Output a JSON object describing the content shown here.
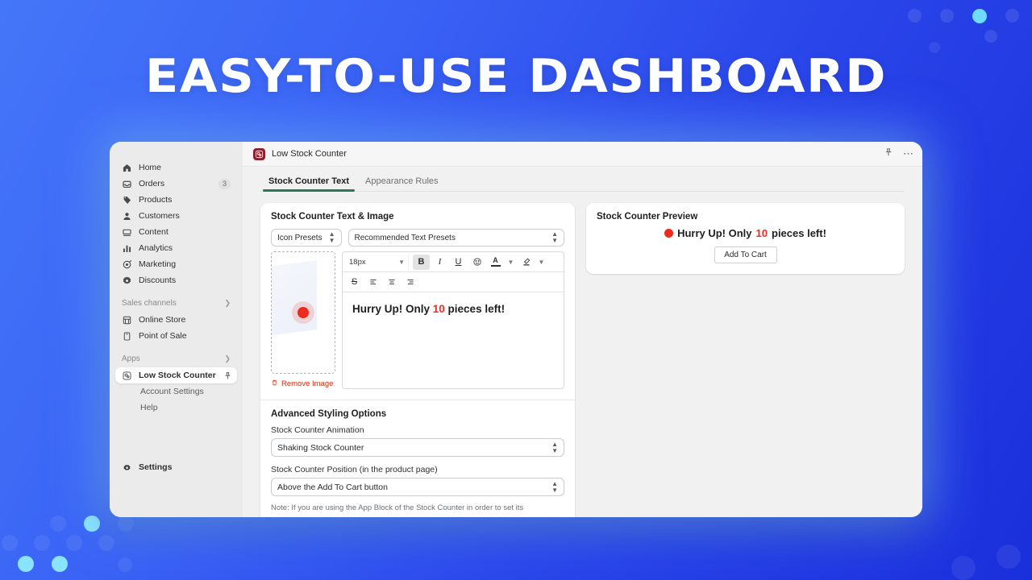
{
  "hero": {
    "headline": "EASY-TO-USE DASHBOARD"
  },
  "sidebar": {
    "items": [
      {
        "label": "Home",
        "icon": "home-icon",
        "badge": ""
      },
      {
        "label": "Orders",
        "icon": "orders-icon",
        "badge": "3"
      },
      {
        "label": "Products",
        "icon": "products-icon",
        "badge": ""
      },
      {
        "label": "Customers",
        "icon": "customers-icon",
        "badge": ""
      },
      {
        "label": "Content",
        "icon": "content-icon",
        "badge": ""
      },
      {
        "label": "Analytics",
        "icon": "analytics-icon",
        "badge": ""
      },
      {
        "label": "Marketing",
        "icon": "marketing-icon",
        "badge": ""
      },
      {
        "label": "Discounts",
        "icon": "discounts-icon",
        "badge": ""
      }
    ],
    "sales_channels_label": "Sales channels",
    "channels": [
      {
        "label": "Online Store",
        "icon": "online-store-icon"
      },
      {
        "label": "Point of Sale",
        "icon": "point-of-sale-icon"
      }
    ],
    "apps_label": "Apps",
    "app_selected": "Low Stock Counter",
    "app_sub_items": [
      "Account Settings",
      "Help"
    ],
    "settings_label": "Settings"
  },
  "topbar": {
    "app_title": "Low Stock Counter",
    "pin_icon": "pin-icon",
    "more_icon": "more-options-icon"
  },
  "tabs": [
    {
      "label": "Stock Counter Text",
      "active": true
    },
    {
      "label": "Appearance Rules",
      "active": false
    }
  ],
  "text_image_card": {
    "title": "Stock Counter Text & Image",
    "icon_presets_label": "Icon Presets",
    "text_presets_value": "Recommended Text Presets",
    "remove_image_label": "Remove Image",
    "toolbar": {
      "font_size": "18px",
      "bold": "B",
      "italic": "I",
      "underline": "U",
      "emoji": "emoji-icon",
      "text_color": "A",
      "highlight": "highlight-pen-icon",
      "strikethrough": "S",
      "align_left": "align-left-icon",
      "align_center": "align-center-icon",
      "align_right": "align-right-icon"
    },
    "editor_text_before": "Hurry Up! Only ",
    "editor_text_number": "10",
    "editor_text_after": " pieces left!"
  },
  "advanced_card": {
    "title": "Advanced Styling Options",
    "animation_label": "Stock Counter Animation",
    "animation_value": "Shaking Stock Counter",
    "position_label": "Stock Counter Position (in the product page)",
    "position_value": "Above the Add To Cart button",
    "note": "Note: If you are using the App Block of the Stock Counter in order to set its"
  },
  "preview_card": {
    "title": "Stock Counter Preview",
    "text_before": "Hurry Up! Only ",
    "text_number": "10",
    "text_after": " pieces left!",
    "button_label": "Add To Cart"
  },
  "colors": {
    "bg_from": "#4476f9",
    "bg_to": "#1a2fdb",
    "accent_green": "#2c7a55",
    "accent_red": "#ee2a1d",
    "app_icon": "#8e1d2e",
    "cyan_dot": "#6fdcff"
  }
}
